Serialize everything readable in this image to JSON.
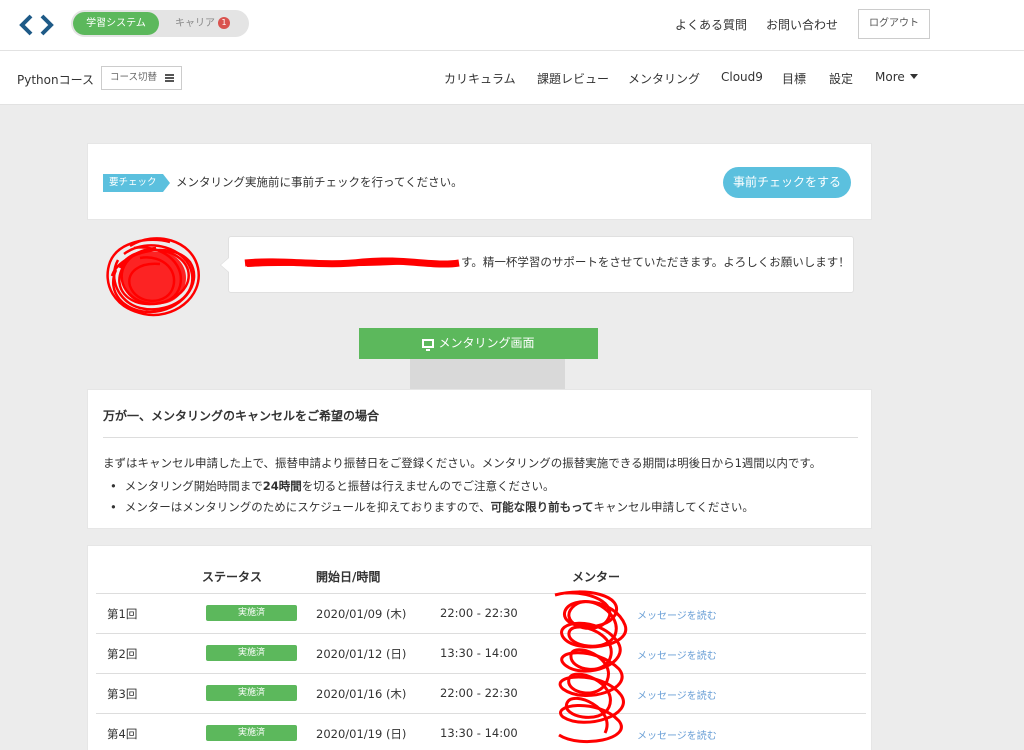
{
  "header": {
    "switch_active": "学習システム",
    "switch_other": "キャリア",
    "career_badge": "1",
    "faq": "よくある質問",
    "contact": "お問い合わせ",
    "logout": "ログアウト"
  },
  "subnav": {
    "course": "Pythonコース",
    "course_switch": "コース切替",
    "items": [
      "カリキュラム",
      "課題レビュー",
      "メンタリング",
      "Cloud9",
      "目標",
      "設定",
      "More"
    ]
  },
  "precheck": {
    "tag": "要チェック",
    "text": "メンタリング実施前に事前チェックを行ってください。",
    "button": "事前チェックをする"
  },
  "mentor_message": {
    "visible_text": "す。精一杯学習のサポートをさせていただきます。よろしくお願いします！"
  },
  "mentoring_button": "メンタリング画面",
  "cancel": {
    "title": "万が一、メンタリングのキャンセルをご希望の場合",
    "body": "まずはキャンセル申請した上で、振替申請より振替日をご登録ください。メンタリングの振替実施できる期間は明後日から1週間以内です。",
    "bullet1_a": "メンタリング開始時間まで",
    "bullet1_bold": "24時間",
    "bullet1_b": "を切ると振替は行えませんのでご注意ください。",
    "bullet2_a": "メンターはメンタリングのためにスケジュールを抑えておりますので、",
    "bullet2_bold": "可能な限り前もって",
    "bullet2_b": "キャンセル申請してください。"
  },
  "sessions": {
    "headers": {
      "status": "ステータス",
      "datetime": "開始日/時間",
      "mentor": "メンター"
    },
    "rows": [
      {
        "label": "第1回",
        "status": "実施済",
        "date": "2020/01/09 (木)",
        "time": "22:00 - 22:30",
        "link": "メッセージを読む"
      },
      {
        "label": "第2回",
        "status": "実施済",
        "date": "2020/01/12 (日)",
        "time": "13:30 - 14:00",
        "link": "メッセージを読む"
      },
      {
        "label": "第3回",
        "status": "実施済",
        "date": "2020/01/16 (木)",
        "time": "22:00 - 22:30",
        "link": "メッセージを読む"
      },
      {
        "label": "第4回",
        "status": "実施済",
        "date": "2020/01/19 (日)",
        "time": "13:30 - 14:00",
        "link": "メッセージを読む"
      }
    ]
  },
  "colors": {
    "primary_green": "#5cb85c",
    "info_blue": "#5bc0de",
    "link_blue": "#6a9fd6",
    "redaction_red": "#ff0000"
  }
}
